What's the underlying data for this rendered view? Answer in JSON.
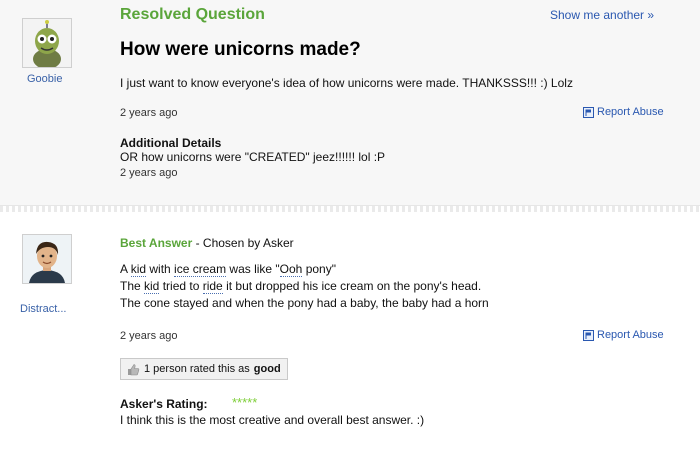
{
  "question": {
    "status": "Resolved Question",
    "show_another": "Show me another »",
    "title": "How were unicorns made?",
    "asker": "Goobie",
    "body": "I just want to know everyone's idea of how unicorns were made. THANKSSS!!! :) Lolz",
    "time": "2 years ago",
    "report": "Report Abuse",
    "details": {
      "title": "Additional Details",
      "body": "OR how unicorns were \"CREATED\" jeez!!!!!! lol :P",
      "time": "2 years ago"
    }
  },
  "answer": {
    "label": "Best Answer",
    "chosen_by": " - Chosen by Asker",
    "answerer": "Distract...",
    "lines": [
      [
        "A ",
        "kid",
        " with ",
        "ice cream",
        " was like \"",
        "Ooh",
        " pony\""
      ],
      [
        "The ",
        "kid",
        " tried to ",
        "ride",
        " it but dropped his ice cream on the pony's head."
      ],
      [
        "The cone stayed and when the pony had a baby, the baby had a horn"
      ]
    ],
    "time": "2 years ago",
    "report": "Report Abuse",
    "rated_prefix": "1 person rated this as ",
    "rated_value": "good",
    "askers_rating_label": "Asker's Rating:",
    "stars": "*****",
    "rating_count": 5,
    "rating_comment": "I think this is the most creative and overall best answer. :)"
  },
  "colors": {
    "green": "#5aa53a",
    "link": "#2a58b0",
    "star": "#7fcf3a"
  }
}
